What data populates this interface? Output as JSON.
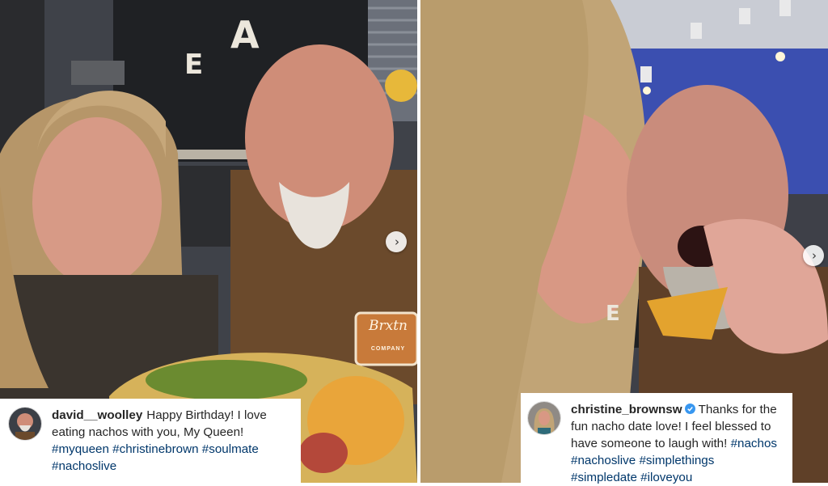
{
  "posts": [
    {
      "user": "david__woolley",
      "verified": false,
      "text": "Happy Birthday! I love eating nachos with you, My Queen!",
      "hashtags": [
        "#myqueen",
        "#christinebrown",
        "#soulmate",
        "#nachoslive"
      ]
    },
    {
      "user": "christine_brownsw",
      "verified": true,
      "text": "Thanks for the fun nacho date love! I feel blessed to have someone to laugh with!",
      "hashtags": [
        "#nachos",
        "#nachoslive",
        "#simplethings",
        "#simpledate",
        "#iloveyou"
      ]
    }
  ],
  "photo_left": {
    "wall_letters": [
      "E",
      "A"
    ],
    "hoodie_logo_line1": "Brxtn",
    "hoodie_logo_line2": "COMPANY"
  },
  "photo_right": {
    "wall_letter": "E"
  },
  "icons": {
    "carousel": "chevron-right-icon",
    "verified": "verified-badge-icon"
  },
  "colors": {
    "hashtag": "#00376b",
    "text": "#262626",
    "verified": "#3897f0"
  }
}
